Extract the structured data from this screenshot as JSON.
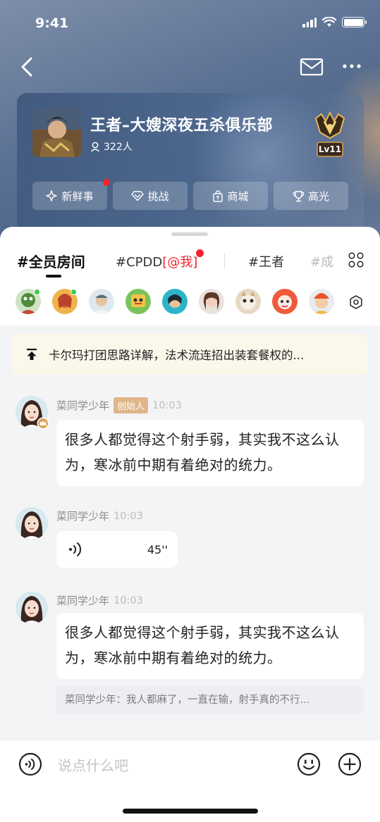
{
  "status_bar": {
    "time": "9:41",
    "icons": [
      "signal-icon",
      "wifi-icon",
      "battery-icon"
    ]
  },
  "nav": {
    "back_icon": "back-icon",
    "mail_icon": "mail-icon",
    "more_icon": "more-icon"
  },
  "club": {
    "name": "王者–大嫂深夜五杀俱乐部",
    "members": "322人",
    "level": "Lv11",
    "buttons": [
      {
        "label": "新鲜事",
        "icon": "sparkle-icon",
        "has_dot": true
      },
      {
        "label": "挑战",
        "icon": "diamond-icon",
        "has_dot": false
      },
      {
        "label": "商城",
        "icon": "shop-icon",
        "has_dot": false
      },
      {
        "label": "高光",
        "icon": "trophy-icon",
        "has_dot": false
      }
    ]
  },
  "tabs": {
    "active": "#全员房间",
    "cpdd": "#CPDD",
    "mention": "[@我]",
    "king": "#王者",
    "faded": "#成"
  },
  "pinned": {
    "text": "卡尔玛打团思路详解，法术流连招出装套餐权的..."
  },
  "messages": [
    {
      "name": "菜同学少年",
      "badge": "创始人",
      "time": "10:03",
      "text": "很多人都觉得这个射手弱，其实我不这么认为，寒冰前中期有着绝对的统力。"
    },
    {
      "name": "菜同学少年",
      "time": "10:03",
      "voice_duration": "45''"
    },
    {
      "name": "菜同学少年",
      "time": "10:03",
      "text": "很多人都觉得这个射手弱，其实我不这么认为，寒冰前中期有着绝对的统力。",
      "quote": "菜同学少年：我人都麻了，一直在输，射手真的不行..."
    }
  ],
  "input": {
    "placeholder": "说点什么吧"
  },
  "colors": {
    "accent_red": "#f5222d",
    "creator_badge": "#dfb589",
    "online": "#3ccb4b"
  }
}
